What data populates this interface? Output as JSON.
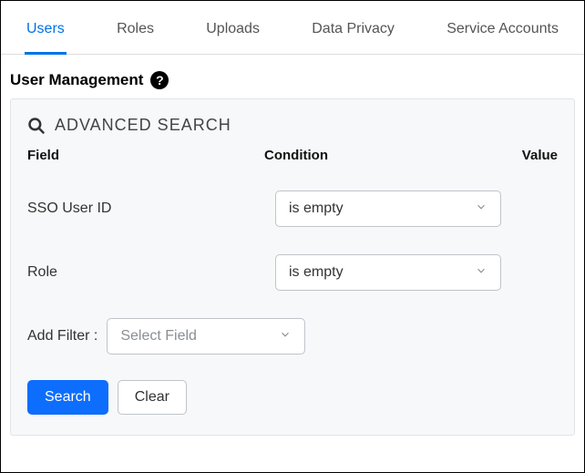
{
  "tabs": {
    "users": "Users",
    "roles": "Roles",
    "uploads": "Uploads",
    "data_privacy": "Data Privacy",
    "service_accounts": "Service Accounts"
  },
  "page_title": "User Management",
  "help_glyph": "?",
  "panel": {
    "title": "ADVANCED SEARCH",
    "headers": {
      "field": "Field",
      "condition": "Condition",
      "value": "Value"
    },
    "filters": {
      "sso": {
        "label": "SSO User ID",
        "condition": "is empty"
      },
      "role": {
        "label": "Role",
        "condition": "is empty"
      }
    },
    "add_filter_label": "Add Filter :",
    "add_filter_placeholder": "Select Field",
    "buttons": {
      "search": "Search",
      "clear": "Clear"
    }
  }
}
